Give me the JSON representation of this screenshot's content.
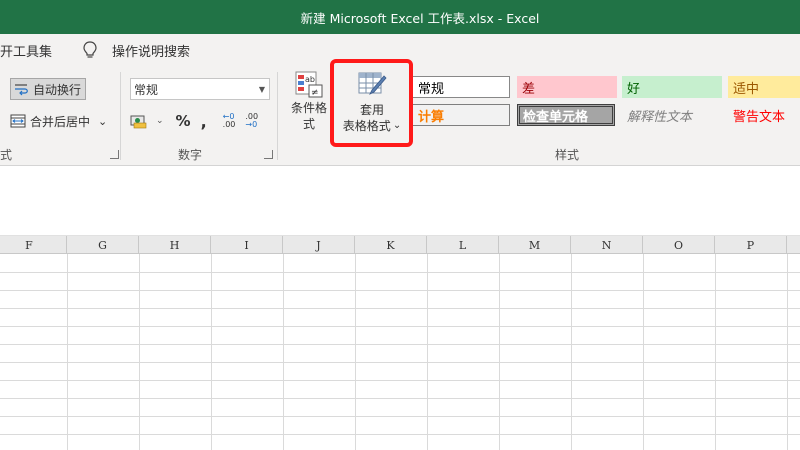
{
  "title_bar": {
    "text": "新建 Microsoft Excel 工作表.xlsx  -  Excel",
    "bg": "#217346"
  },
  "tell_row": {
    "partial_tab": "开工具集",
    "search_label": "操作说明搜索"
  },
  "alignment_group": {
    "wrap_text": "自动换行",
    "merge_center": "合并后居中",
    "dropdown_glyph": "⌄",
    "group_label_partial": "式"
  },
  "number_group": {
    "format_value": "常规",
    "percent": "%",
    "comma": ",",
    "dec_increase": ".00",
    "dec_decrease": ".00",
    "group_label": "数字"
  },
  "styles_group": {
    "conditional_format": "条件格式",
    "table_format_line1": "套用",
    "table_format_line2": "表格格式",
    "group_label": "样式",
    "cells": [
      {
        "key": "normal",
        "text": "常规"
      },
      {
        "key": "bad",
        "text": "差"
      },
      {
        "key": "good",
        "text": "好"
      },
      {
        "key": "neutral",
        "text": "适中"
      },
      {
        "key": "calc",
        "text": "计算"
      },
      {
        "key": "check",
        "text": "检查单元格"
      },
      {
        "key": "explanatory",
        "text": "解释性文本"
      },
      {
        "key": "warning",
        "text": "警告文本"
      }
    ],
    "colors": {
      "bad_bg": "#ffc7ce",
      "bad_fg": "#9c0006",
      "good_bg": "#c6efce",
      "good_fg": "#006100",
      "neutral_bg": "#ffeb9c",
      "neutral_fg": "#9c5700",
      "calc_fg": "#fa7d00",
      "warning_fg": "#ff0000",
      "highlight": "#ff1a1a"
    }
  },
  "grid": {
    "columns": [
      "F",
      "G",
      "H",
      "I",
      "J",
      "K",
      "L",
      "M",
      "N",
      "O",
      "P"
    ]
  }
}
